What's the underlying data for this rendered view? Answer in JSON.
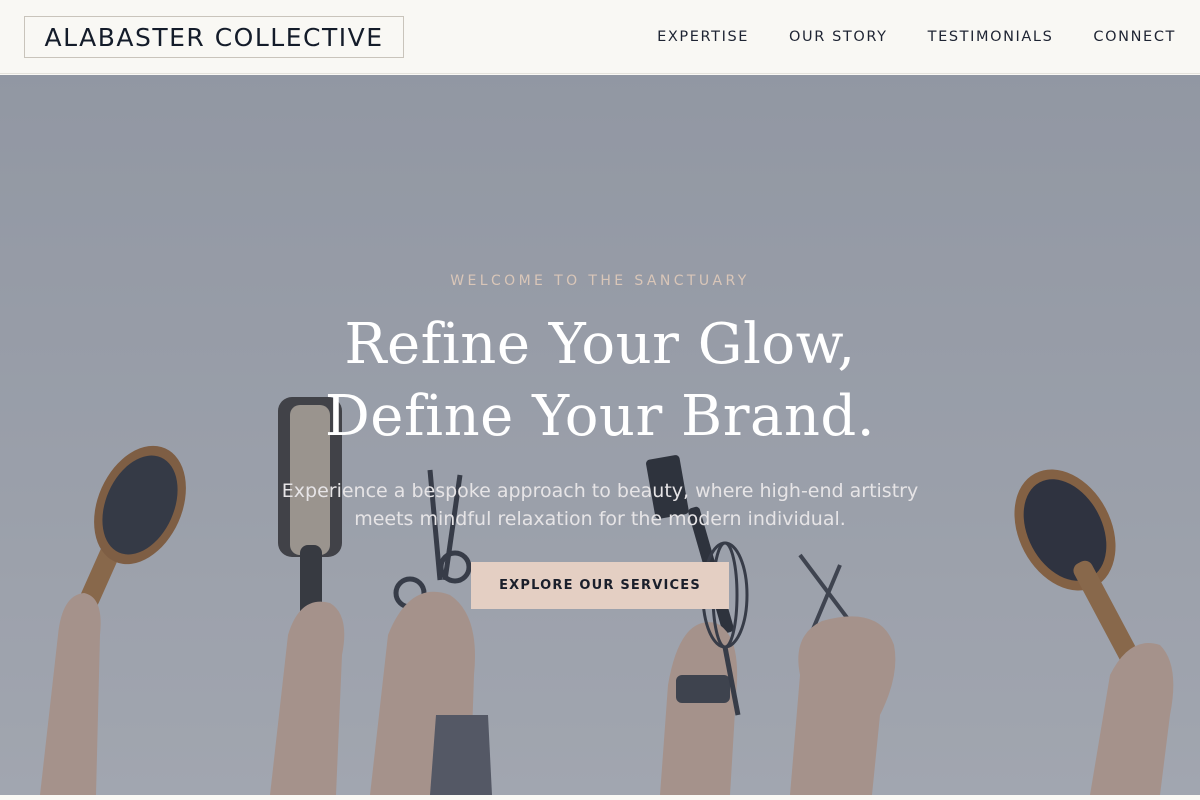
{
  "header": {
    "logo": "ALABASTER COLLECTIVE",
    "nav": [
      {
        "label": "EXPERTISE"
      },
      {
        "label": "OUR STORY"
      },
      {
        "label": "TESTIMONIALS"
      },
      {
        "label": "CONNECT"
      }
    ]
  },
  "hero": {
    "eyebrow": "WELCOME TO THE SANCTUARY",
    "headline_line1": "Refine Your Glow,",
    "headline_line2": "Define Your Brand.",
    "subhead": "Experience a bespoke approach to beauty, where high-end artistry meets mindful relaxation for the modern individual.",
    "cta_label": "EXPLORE OUR SERVICES",
    "background_image": "hands-holding-hair-tools-photo"
  },
  "colors": {
    "header_bg": "#f9f8f4",
    "text_dark": "#141c2a",
    "accent_eyebrow": "#d9c6b8",
    "cta_bg": "#e4cfc3",
    "overlay": "#464e62"
  }
}
